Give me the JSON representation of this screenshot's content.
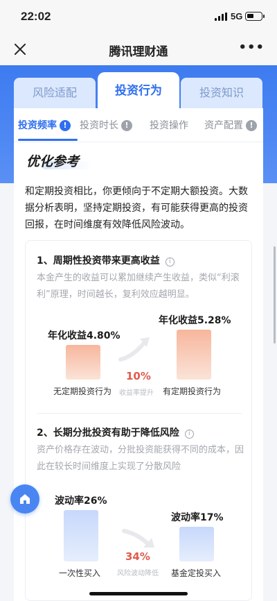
{
  "status_bar": {
    "time": "22:02",
    "network": "5G"
  },
  "navbar": {
    "title": "腾讯理财通"
  },
  "tabs": [
    {
      "label": "风险适配"
    },
    {
      "label": "投资行为"
    },
    {
      "label": "投资知识"
    }
  ],
  "subtabs": [
    {
      "label": "投资频率",
      "alert": "!"
    },
    {
      "label": "投资时长"
    },
    {
      "label": "投资操作"
    },
    {
      "label": "资产配置",
      "alert": "!"
    }
  ],
  "optimization": {
    "title": "优化参考",
    "intro": "和定期投资相比，你更倾向于不定期大额投资。大数据分析表明，坚持定期投资，有可能获得更高的投资回报，在时间维度有效降低风险波动。"
  },
  "section1": {
    "title": "1、周期性投资带来更高收益",
    "info": "i",
    "desc": "本金产生的收益可以累加继续产生收益，类似“利滚利”原理，时间越长，复利效应越明显。",
    "left_label": "年化收益4.80%",
    "left_caption": "无定期投资行为",
    "right_label": "年化收益5.28%",
    "right_caption": "有定期投资行为",
    "change_pct": "10%",
    "change_caption": "收益率提升",
    "left_value": 4.8,
    "right_value": 5.28
  },
  "section2": {
    "title": "2、长期分批投资有助于降低风险",
    "info": "i",
    "desc": "资产价格存在波动，分批投资能获得不同的成本，因此在较长时间维度上实现了分散风险",
    "left_label": "波动率26%",
    "left_caption": "一次性买入",
    "right_label": "波动率17%",
    "right_caption": "基金定投买入",
    "change_pct": "34%",
    "change_caption": "风险波动降低",
    "left_value": 26,
    "right_value": 17
  },
  "colors": {
    "accent": "#2f6ff0",
    "highlight": "#e05b4b"
  },
  "icons": [
    "close-icon",
    "more-icon",
    "alert-icon",
    "info-icon",
    "arrow-icon",
    "home-icon",
    "signal-icon",
    "battery-icon"
  ]
}
